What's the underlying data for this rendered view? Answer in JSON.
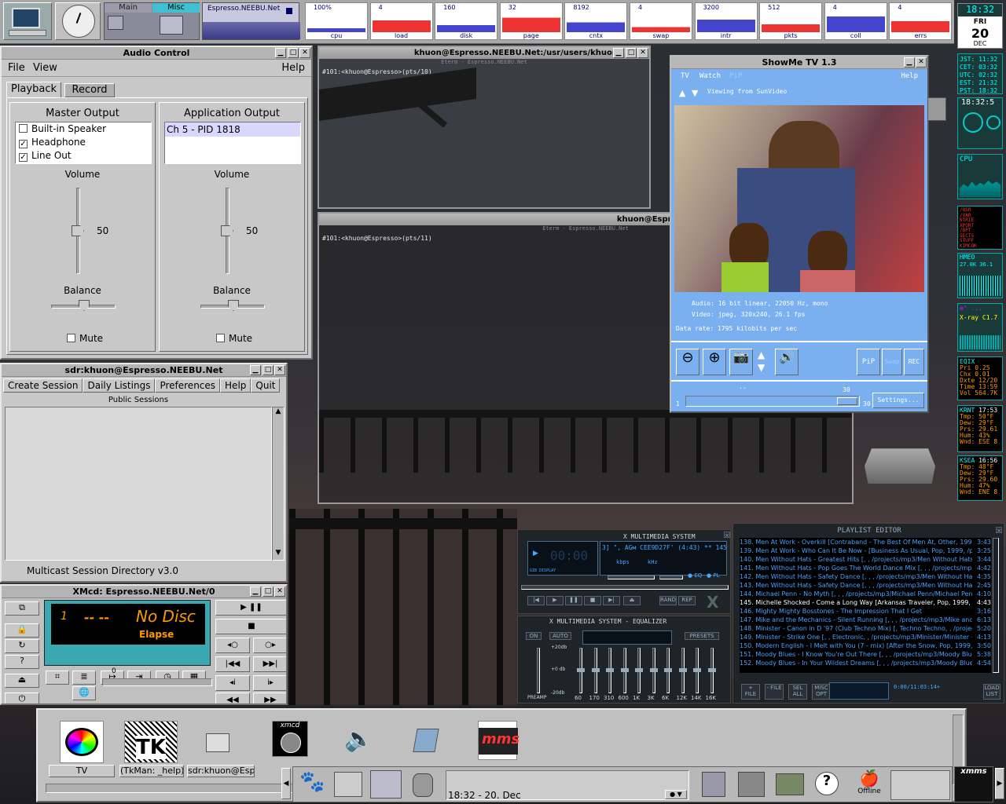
{
  "top_panel": {
    "desk_main": "Main",
    "desk_misc": "Misc",
    "net_label": "Espresso.NEEBU.Net",
    "graphs": [
      {
        "value": "100%",
        "label": "cpu"
      },
      {
        "value": "4",
        "label": "load"
      },
      {
        "value": "160",
        "label": "disk"
      },
      {
        "value": "32",
        "label": "page"
      },
      {
        "value": "8192",
        "label": "cntx"
      },
      {
        "value": "4",
        "label": "swap"
      },
      {
        "value": "3200",
        "label": "intr"
      },
      {
        "value": "512",
        "label": "pkts"
      },
      {
        "value": "4",
        "label": "coll"
      },
      {
        "value": "4",
        "label": "errs"
      }
    ]
  },
  "clock": {
    "time": "18:32",
    "day": "FRI",
    "date": "20",
    "month": "DEC"
  },
  "world_clock": [
    "JST: 11:32",
    "CET: 03:32",
    "UTC: 02:32",
    "EST: 21:32",
    "PST: 18:32"
  ],
  "side_apps": {
    "clock2": "18:32:5",
    "cpu": "CPU",
    "mem_labels": [
      "/USR",
      "/VAR",
      "NTRIE",
      "XPORT",
      "/OPT",
      "SECTS",
      "STUFF",
      "KIMCOR"
    ],
    "hmeo": "HMEO",
    "hmeo_vals": "27.0K 36.1",
    "xray": "X-ray C1.7",
    "eqix": {
      "title": "EQIX",
      "rows": [
        "Pri 0.25",
        "Chx 0.01",
        "Dxte 12/20",
        "Time 13:59",
        "Vol 564.7K"
      ]
    },
    "krnt": {
      "title": "KRNT",
      "time": "17:53",
      "rows": [
        "Tmp: 50°F",
        "Dew: 29°F",
        "Prs: 29.61",
        "Hum: 43%",
        "Wnd: ESE 8"
      ]
    },
    "ksea": {
      "title": "KSEA",
      "time": "16:56",
      "rows": [
        "Tmp: 48°F",
        "Dew: 29°F",
        "Prs: 29.60",
        "Hum: 47%",
        "Wnd: ENE 8"
      ]
    }
  },
  "audio": {
    "title": "Audio Control",
    "menu": [
      "File",
      "View"
    ],
    "help": "Help",
    "tabs": [
      "Playback",
      "Record"
    ],
    "master": {
      "title": "Master Output",
      "items": [
        {
          "label": "Built-in Speaker",
          "checked": false
        },
        {
          "label": "Headphone",
          "checked": true
        },
        {
          "label": "Line Out",
          "checked": true
        }
      ],
      "volume_label": "Volume",
      "volume": "50",
      "balance_label": "Balance",
      "mute": "Mute"
    },
    "app": {
      "title": "Application Output",
      "item": "Ch 5 - PID 1818",
      "volume_label": "Volume",
      "volume": "50",
      "balance_label": "Balance",
      "mute": "Mute"
    }
  },
  "sdr": {
    "title": "sdr:khuon@Espresso.NEEBU.Net",
    "menu": [
      "Create Session",
      "Daily Listings",
      "Preferences",
      "Help",
      "Quit"
    ],
    "header": "Public Sessions",
    "status": "Multicast Session Directory v3.0"
  },
  "xmcd": {
    "title": "XMcd: Espresso.NEEBU.Net/0",
    "track": "1",
    "time": "-- --",
    "disc": "No Disc",
    "mode": "Elapse",
    "vol": "0"
  },
  "term1": {
    "title": "khuon@Espresso.NEEBU.Net:/usr/users/khuon",
    "subtitle": "Eterm - Espresso.NEEBU.Net",
    "prompt": "#101:<khuon@Espresso>(pts/10)"
  },
  "term2": {
    "title": "khuon@Espresso.NEEBU.Net:/usr/users/khuon",
    "subtitle": "Eterm - Espresso.NEEBU.Net",
    "prompt": "#101:<khuon@Espresso>(pts/11)"
  },
  "showme": {
    "title": "ShowMe TV 1.3",
    "menu": [
      "TV",
      "Watch",
      "PiP"
    ],
    "help": "Help",
    "status": "Viewing from SunVideo",
    "audio": "Audio: 16 bit linear, 22050 Hz, mono",
    "video": "Video: jpeg, 320x240, 26.1 fps",
    "rate": "Data rate: 1795 kilobits per sec",
    "pip": "PiP",
    "swap": "Swap",
    "rec": "REC",
    "settings": "Settings...",
    "scale_min": "1",
    "scale_max": "30",
    "scale_top": "30",
    "scale_dots": ".."
  },
  "xmms": {
    "title": "X MULTIMEDIA SYSTEM",
    "time": "00:00",
    "songinfo": "3] \", AGм CEE9D27F' (4:43) ** 145. Mi",
    "kbps": "kbps",
    "khz": "kHz",
    "brand": "GIB DISPLAY",
    "eq_title": "X MULTIMEDIA SYSTEM - EQUALIZER",
    "on": "ON",
    "auto": "AUTO",
    "presets": "PRESETS",
    "preamp": "PREAMP",
    "db": [
      "+20db",
      "+0 db",
      "-20db"
    ],
    "bands": [
      "60",
      "170",
      "310",
      "600",
      "1K",
      "3K",
      "6K",
      "12K",
      "14K",
      "16K"
    ],
    "rand": "RAND",
    "rep": "REP",
    "eq": "EQ",
    "pl": "PL"
  },
  "playlist": {
    "title": "PLAYLIST EDITOR",
    "items": [
      {
        "text": "138. Men At Work - Overkill [Contraband - The Best Of Men At, Other, 1996, /...",
        "time": "3:43"
      },
      {
        "text": "139. Men At Work - Who Can It Be Now - [Business As Usual, Pop, 1999, /proj...",
        "time": "3:25"
      },
      {
        "text": "140. Men Without Hats - Greatest Hits [, , /projects/mp3/Men Without Hats/Me...",
        "time": "3:44"
      },
      {
        "text": "141. Men Without Hats - Pop Goes The World Dance Mix [, , , /projects/mp3/Men...",
        "time": "4:42"
      },
      {
        "text": "142. Men Without Hats - Safety Dance [, , , /projects/mp3/Men Without Hats/Me...",
        "time": "4:35"
      },
      {
        "text": "143. Men Without Hats - Safety Dance [, , , /projects/mp3/Men Without Hats/Me...",
        "time": "2:45"
      },
      {
        "text": "144. Michael Penn - No Myth [, , , /projects/mp3/Michael Penn/Michael Penn -...",
        "time": "4:10"
      },
      {
        "text": "145. Michelle Shocked - Come a Long Way [Arkansas Traveler, Pop, 1999, /pr...",
        "time": "4:43"
      },
      {
        "text": "146. Mighty Mighty Bosstones - The Impression That I Get",
        "time": "3:16"
      },
      {
        "text": "147. Mike and the Mechanics - Silent Running [, , , /projects/mp3/Mike and the...",
        "time": "6:13"
      },
      {
        "text": "148. Minister - Canon in D '97 (Club Techno Mix) [, Techno Techno, , /projects/...",
        "time": "5:20"
      },
      {
        "text": "149. Minister - Strike One [, , Electronic, , /projects/mp3/Minister/Minister - Stri...",
        "time": "4:13"
      },
      {
        "text": "150. Modern English - I Melt with You (7 - mix) [After the Snow, Pop, 1999, /pr...",
        "time": "3:50"
      },
      {
        "text": "151. Moody Blues - I Know You're Out There [, , , /projects/mp3/Moody Blues/M...",
        "time": "5:38"
      },
      {
        "text": "152. Moody Blues - In Your Wildest Dreams [, , , /projects/mp3/Moody Blues/M...",
        "time": "4:54"
      }
    ],
    "btns": [
      "+ FILE",
      "- FILE",
      "SEL ALL",
      "MISC OPT"
    ],
    "total": "0:00/11:03:14+",
    "load": "LOAD LIST"
  },
  "taskbar": {
    "labels": [
      "TV",
      "(TkMan: _help)",
      "sdr:khuon@Espr"
    ],
    "xmcd_icon": "xmcd",
    "clock": "18:32 - 20. Dec",
    "offline": "Offline",
    "xmms": "xmms",
    "mms": "mms",
    "tk": "TK"
  }
}
